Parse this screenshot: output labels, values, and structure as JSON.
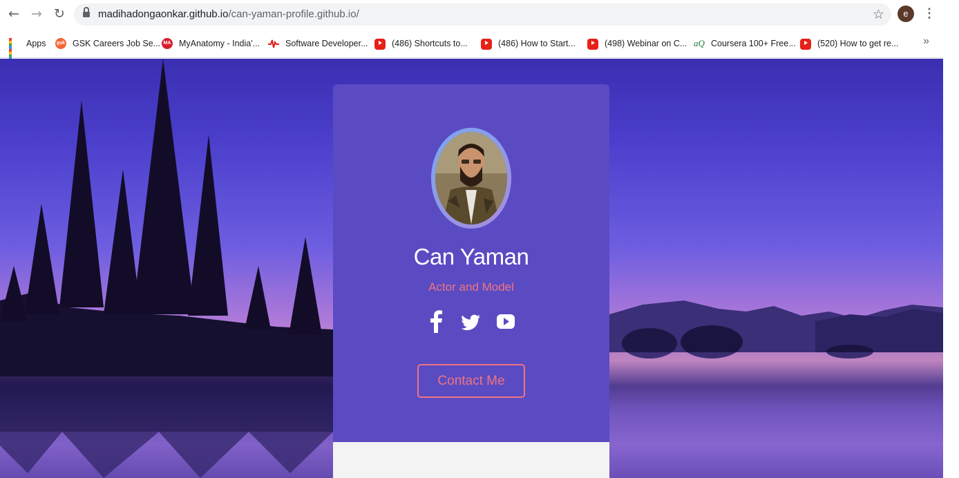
{
  "browser": {
    "url_host": "madihadongaonkar.github.io",
    "url_path": "/can-yaman-profile.github.io/",
    "profile_initial": "e",
    "nav": {
      "back_icon": "←",
      "forward_icon": "→",
      "reload_icon": "↻",
      "star_icon": "☆",
      "menu_icon": "⋮",
      "more_icon": "»"
    }
  },
  "bookmarks": [
    {
      "label": "Apps",
      "icon": "apps-grid-icon"
    },
    {
      "label": "GSK Careers Job Se...",
      "icon": "gsk-icon",
      "badge": "gsk"
    },
    {
      "label": "MyAnatomy - India'...",
      "icon": "myanatomy-icon",
      "badge": "MA"
    },
    {
      "label": "Software Developer...",
      "icon": "pulse-icon",
      "badge": "♉"
    },
    {
      "label": "(486) Shortcuts to...",
      "icon": "youtube-icon"
    },
    {
      "label": "(486) How to Start...",
      "icon": "youtube-icon"
    },
    {
      "label": "(498) Webinar on C...",
      "icon": "youtube-icon"
    },
    {
      "label": "Coursera 100+ Free...",
      "icon": "aq-icon",
      "badge": "aQ"
    },
    {
      "label": "(520) How to get re...",
      "icon": "youtube-icon"
    }
  ],
  "profile": {
    "name": "Can Yaman",
    "role": "Actor and Model",
    "contact_label": "Contact Me",
    "socials": [
      "facebook-icon",
      "twitter-icon",
      "youtube-icon"
    ]
  },
  "colors": {
    "card": "#5a4bc3",
    "accent": "#f0747f",
    "name": "#ffffff"
  }
}
